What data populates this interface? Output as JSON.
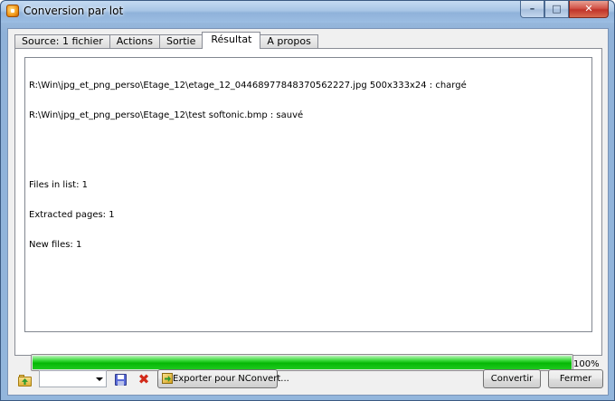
{
  "window": {
    "title": "Conversion par lot",
    "icon": "app-conversion-icon"
  },
  "caption_buttons": {
    "minimize": "–",
    "maximize": "□",
    "close": "✕"
  },
  "tabs": [
    {
      "label": "Source: 1 fichier",
      "active": false
    },
    {
      "label": "Actions",
      "active": false
    },
    {
      "label": "Sortie",
      "active": false
    },
    {
      "label": "Résultat",
      "active": true
    },
    {
      "label": "A propos",
      "active": false
    }
  ],
  "result": {
    "log_lines": [
      "R:\\Win\\jpg_et_png_perso\\Etage_12\\etage_12_04468977848370562227.jpg 500x333x24 : chargé",
      "R:\\Win\\jpg_et_png_perso\\Etage_12\\test softonic.bmp : sauvé"
    ],
    "summary_lines": [
      "Files in list: 1",
      "Extracted pages: 1",
      "New files: 1"
    ]
  },
  "progress": {
    "value": 100,
    "label": "100%",
    "color": "#0bbf0b"
  },
  "bottom": {
    "preset_value": "",
    "export_label": "Exporter pour NConvert...",
    "convert_label": "Convertir",
    "close_label": "Fermer"
  }
}
